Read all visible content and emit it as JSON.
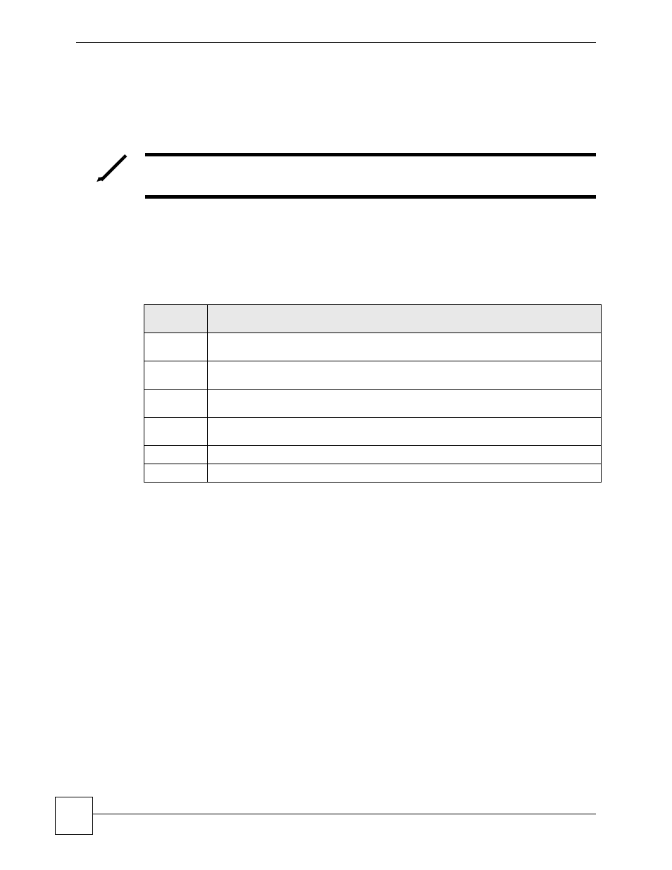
{
  "header": {
    "running_head": ""
  },
  "note": {
    "text": ""
  },
  "table": {
    "headers": [
      "",
      ""
    ],
    "rows": [
      [
        "",
        ""
      ],
      [
        "",
        ""
      ],
      [
        "",
        ""
      ],
      [
        "",
        ""
      ],
      [
        "",
        ""
      ],
      [
        "",
        ""
      ]
    ]
  },
  "footer": {
    "page_number": ""
  }
}
